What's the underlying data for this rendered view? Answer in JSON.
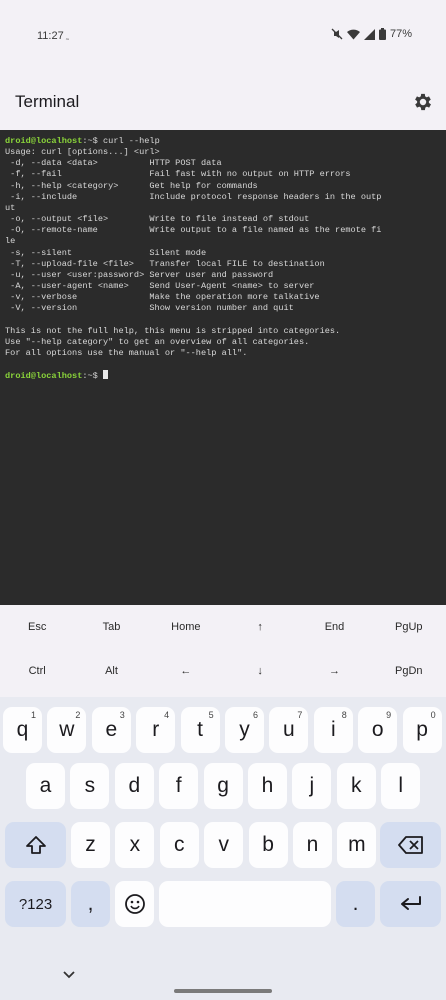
{
  "status": {
    "time": "11:27",
    "battery": "77%"
  },
  "appbar": {
    "title": "Terminal"
  },
  "terminal": {
    "prompt": "droid@localhost",
    "prompt_suffix": ":~$ ",
    "command": "curl --help",
    "output": [
      "Usage: curl [options...] <url>",
      " -d, --data <data>          HTTP POST data",
      " -f, --fail                 Fail fast with no output on HTTP errors",
      " -h, --help <category>      Get help for commands",
      " -i, --include              Include protocol response headers in the outp",
      "ut",
      " -o, --output <file>        Write to file instead of stdout",
      " -O, --remote-name          Write output to a file named as the remote fi",
      "le",
      " -s, --silent               Silent mode",
      " -T, --upload-file <file>   Transfer local FILE to destination",
      " -u, --user <user:password> Server user and password",
      " -A, --user-agent <name>    Send User-Agent <name> to server",
      " -v, --verbose              Make the operation more talkative",
      " -V, --version              Show version number and quit",
      "",
      "This is not the full help, this menu is stripped into categories.",
      "Use \"--help category\" to get an overview of all categories.",
      "For all options use the manual or \"--help all\"."
    ]
  },
  "extra_keys": {
    "row1": [
      "Esc",
      "Tab",
      "Home",
      "↑",
      "End",
      "PgUp"
    ],
    "row2": [
      "Ctrl",
      "Alt",
      "←",
      "↓",
      "→",
      "PgDn"
    ]
  },
  "keyboard": {
    "row1": [
      {
        "k": "q",
        "h": "1"
      },
      {
        "k": "w",
        "h": "2"
      },
      {
        "k": "e",
        "h": "3"
      },
      {
        "k": "r",
        "h": "4"
      },
      {
        "k": "t",
        "h": "5"
      },
      {
        "k": "y",
        "h": "6"
      },
      {
        "k": "u",
        "h": "7"
      },
      {
        "k": "i",
        "h": "8"
      },
      {
        "k": "o",
        "h": "9"
      },
      {
        "k": "p",
        "h": "0"
      }
    ],
    "row2": [
      "a",
      "s",
      "d",
      "f",
      "g",
      "h",
      "j",
      "k",
      "l"
    ],
    "row3": [
      "z",
      "x",
      "c",
      "v",
      "b",
      "n",
      "m"
    ],
    "symbols_label": "?123",
    "comma": ",",
    "period": "."
  }
}
